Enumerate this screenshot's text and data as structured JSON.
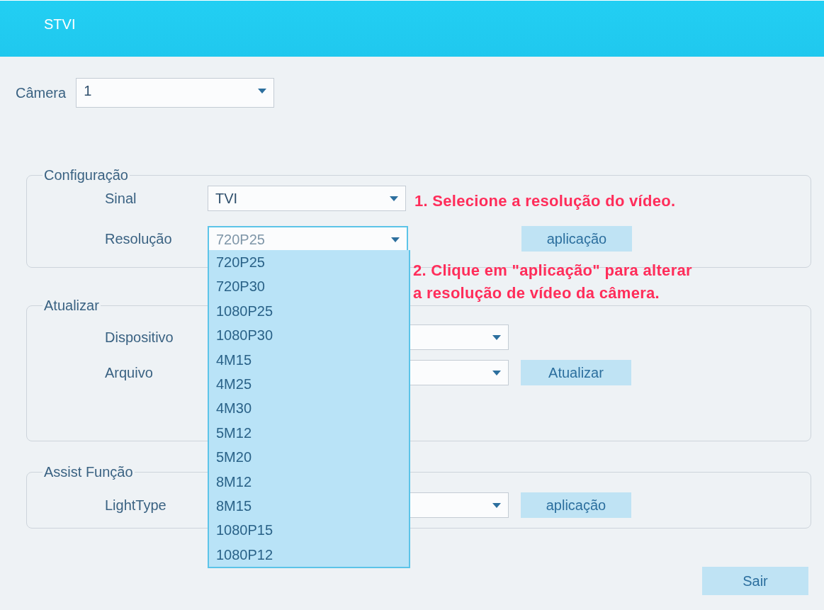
{
  "window": {
    "title": "STVI"
  },
  "camera": {
    "label": "Câmera",
    "value": "1"
  },
  "groups": [
    {
      "legend": "Configuração",
      "rows": [
        {
          "label": "Sinal",
          "value": "TVI",
          "open": false
        },
        {
          "label": "Resolução",
          "value": "720P25",
          "open": true,
          "button": "aplicação"
        }
      ]
    },
    {
      "legend": "Atualizar",
      "rows": [
        {
          "label": "Dispositivo",
          "value": "",
          "open": false
        },
        {
          "label": "Arquivo",
          "value": "",
          "open": false,
          "button": "Atualizar"
        }
      ]
    },
    {
      "legend": "Assist Função",
      "rows": [
        {
          "label": "LightType",
          "value": "",
          "open": false,
          "button": "aplicação"
        }
      ]
    }
  ],
  "dropdown_options": [
    {
      "label": "720P25",
      "selected": false
    },
    {
      "label": "720P30",
      "selected": false
    },
    {
      "label": "1080P25",
      "selected": false
    },
    {
      "label": "1080P30",
      "selected": false
    },
    {
      "label": "4M15",
      "selected": false
    },
    {
      "label": "4M25",
      "selected": false
    },
    {
      "label": "4M30",
      "selected": false
    },
    {
      "label": "5M12",
      "selected": false
    },
    {
      "label": "5M20",
      "selected": false
    },
    {
      "label": "8M12",
      "selected": false
    },
    {
      "label": "8M15",
      "selected": false
    },
    {
      "label": "1080P15",
      "selected": false
    },
    {
      "label": "1080P12",
      "selected": false
    }
  ],
  "annotations": [
    "1. Selecione a resolução do vídeo.",
    "2. Clique em \"aplicação\" para alterar\na resolução de vídeo da câmera."
  ],
  "exit_button": "Sair"
}
